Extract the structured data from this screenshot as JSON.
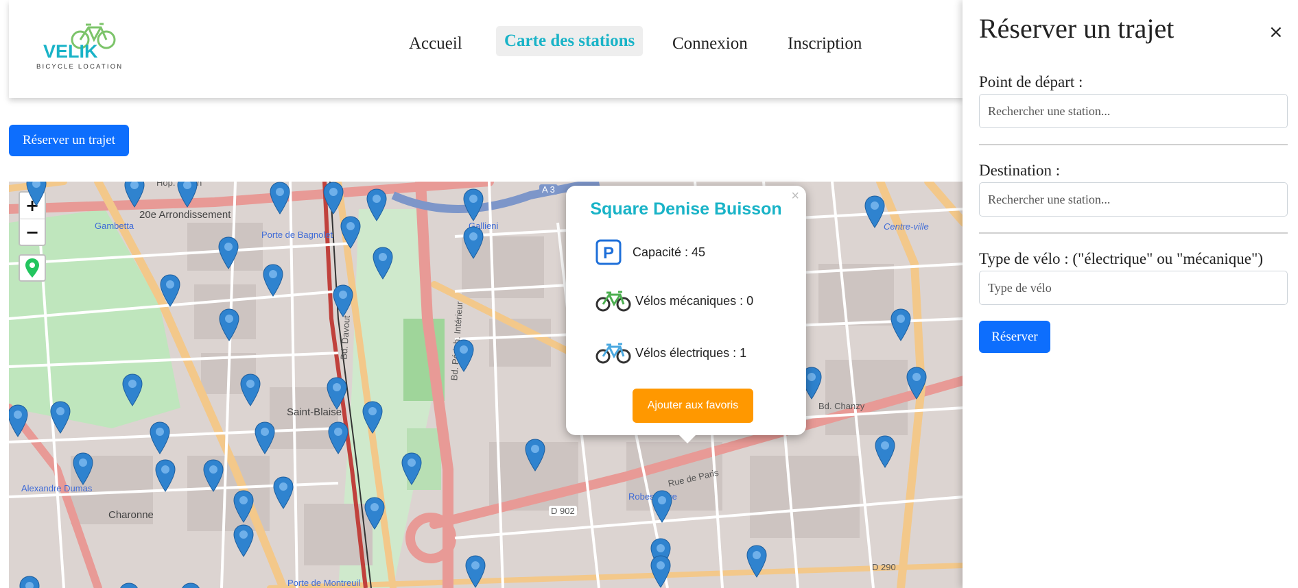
{
  "logo": {
    "name": "VELIK",
    "tagline": "BICYCLE LOCATION"
  },
  "nav": {
    "items": [
      "Accueil",
      "Carte des stations",
      "Connexion",
      "Inscription"
    ],
    "active": "Carte des stations"
  },
  "reserve_button": "Réserver un trajet",
  "map": {
    "zoom_in": "+",
    "zoom_out": "−",
    "labels": {
      "hop_tenon": "Hop. Tenon",
      "arrondissement": "20e Arrondissement",
      "gambetta": "Gambetta",
      "porte_bagnolet": "Porte de Bagnolet",
      "porte_bagnolet_2": "Porte\nde Bagnolet",
      "gallieni": "Gallieni",
      "saint_blaise": "Saint-Blaise",
      "alexandre_dumas": "Alexandre\nDumas",
      "charonne": "Charonne",
      "robespierre": "Robespierre",
      "rue_de_paris": "Rue de Paris",
      "centre_ville": "Centre-ville",
      "bd_chanzy": "Bd. Chanzy",
      "d902": "D 902",
      "d290": "D 290",
      "porte_montreuil": "Porte de Montreuil",
      "bd_periph": "Bd. Périph. Intérieur",
      "bd_davout": "Bd. Davout",
      "a3": "A 3"
    }
  },
  "popup": {
    "close": "×",
    "title": "Square Denise Buisson",
    "capacity": "Capacité : 45",
    "mechanical": "Vélos mécaniques : 0",
    "electric": "Vélos électriques : 1",
    "favorite_button": "Ajouter aux favoris"
  },
  "panel": {
    "title": "Réserver un trajet",
    "close": "×",
    "departure_label": "Point de départ :",
    "departure_placeholder": "Rechercher une station...",
    "destination_label": "Destination :",
    "destination_placeholder": "Rechercher une station...",
    "bike_type_label": "Type de vélo : (\"électrique\" ou \"mécanique\")",
    "bike_type_placeholder": "Type de vélo",
    "submit": "Réserver"
  },
  "colors": {
    "accent": "#19b3c7",
    "primary": "#0d6efd",
    "favorite": "#ff9800",
    "marker": "#2f83cf"
  }
}
